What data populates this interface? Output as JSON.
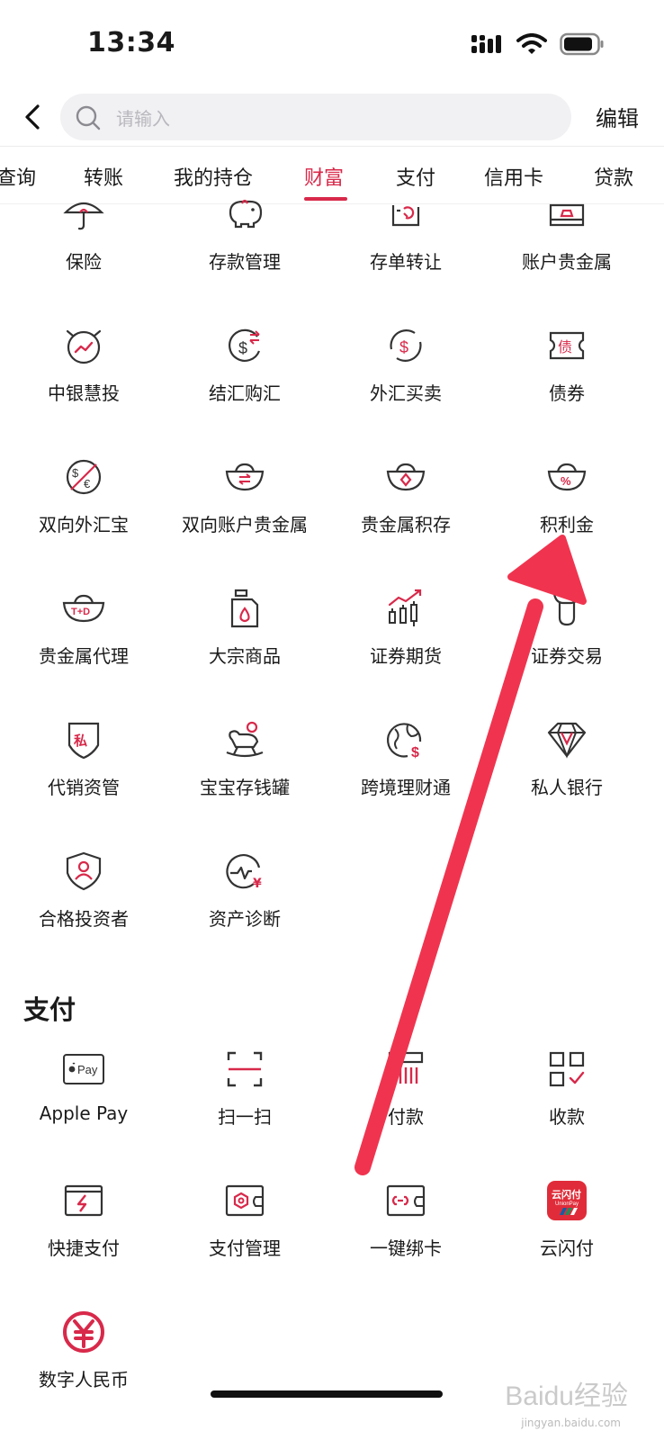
{
  "status_bar": {
    "time": "13:34"
  },
  "header": {
    "search_placeholder": "请输入",
    "edit_label": "编辑"
  },
  "tabs": [
    {
      "label": "查询"
    },
    {
      "label": "转账"
    },
    {
      "label": "我的持仓"
    },
    {
      "label": "财富",
      "active": true
    },
    {
      "label": "支付"
    },
    {
      "label": "信用卡"
    },
    {
      "label": "贷款"
    }
  ],
  "wealth_items": [
    {
      "label": "保险",
      "icon": "umbrella-icon"
    },
    {
      "label": "存款管理",
      "icon": "piggy-bank-icon"
    },
    {
      "label": "存单转让",
      "icon": "certificate-transfer-icon"
    },
    {
      "label": "账户贵金属",
      "icon": "gold-account-icon"
    },
    {
      "label": "中银慧投",
      "icon": "alarm-chart-icon"
    },
    {
      "label": "结汇购汇",
      "icon": "exchange-settle-icon"
    },
    {
      "label": "外汇买卖",
      "icon": "forex-trade-icon"
    },
    {
      "label": "债券",
      "icon": "bond-ticket-icon"
    },
    {
      "label": "双向外汇宝",
      "icon": "dual-forex-icon"
    },
    {
      "label": "双向账户贵金属",
      "icon": "dual-gold-icon"
    },
    {
      "label": "贵金属积存",
      "icon": "gold-accumulation-icon"
    },
    {
      "label": "积利金",
      "icon": "gold-percent-icon"
    },
    {
      "label": "贵金属代理",
      "icon": "gold-td-icon"
    },
    {
      "label": "大宗商品",
      "icon": "oil-can-icon"
    },
    {
      "label": "证券期货",
      "icon": "candlestick-icon"
    },
    {
      "label": "证券交易",
      "icon": "bull-icon"
    },
    {
      "label": "代销资管",
      "icon": "private-shield-icon"
    },
    {
      "label": "宝宝存钱罐",
      "icon": "rocking-horse-icon"
    },
    {
      "label": "跨境理财通",
      "icon": "globe-dollar-icon"
    },
    {
      "label": "私人银行",
      "icon": "diamond-icon"
    },
    {
      "label": "合格投资者",
      "icon": "user-shield-icon"
    },
    {
      "label": "资产诊断",
      "icon": "pulse-yuan-icon"
    }
  ],
  "payment_section": {
    "title": "支付",
    "items": [
      {
        "label": "Apple Pay",
        "icon": "apple-pay-icon",
        "badge": "Pay"
      },
      {
        "label": "扫一扫",
        "icon": "scan-icon"
      },
      {
        "label": "付款",
        "icon": "barcode-pay-icon"
      },
      {
        "label": "收款",
        "icon": "qr-receive-icon"
      },
      {
        "label": "快捷支付",
        "icon": "quick-pay-card-icon"
      },
      {
        "label": "支付管理",
        "icon": "wallet-manage-icon"
      },
      {
        "label": "一键绑卡",
        "icon": "bind-card-icon"
      },
      {
        "label": "云闪付",
        "icon": "unionpay-quickpass-icon",
        "badge": "云闪付",
        "badge_sub": "UnionPay"
      },
      {
        "label": "数字人民币",
        "icon": "digital-rmb-icon"
      }
    ]
  },
  "watermark": {
    "text": "Baidu经验",
    "sub": "jingyan.baidu.com"
  },
  "colors": {
    "accent": "#d8294a",
    "arrow": "#f0344f",
    "text": "#1a1a1a"
  }
}
